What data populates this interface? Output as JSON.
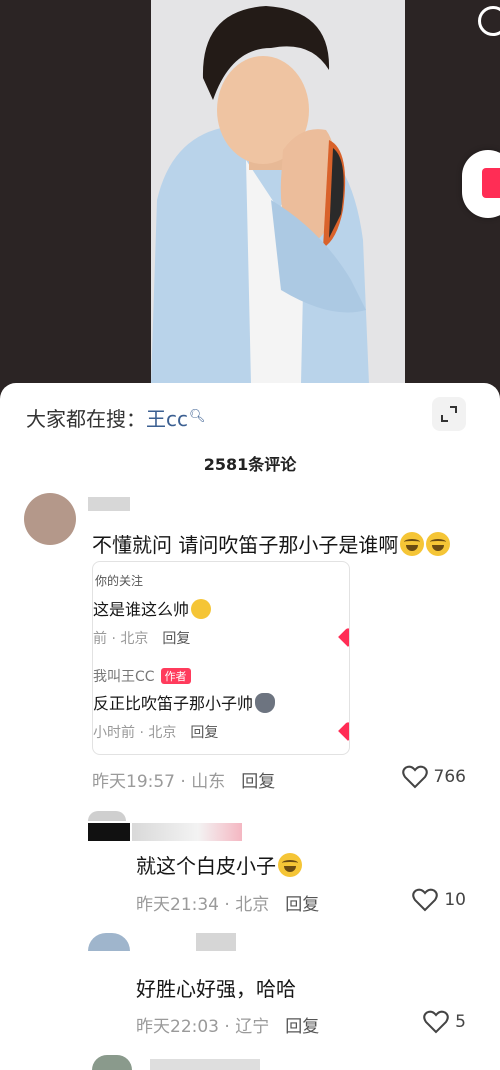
{
  "search": {
    "prefix": "大家都在搜：",
    "keyword": "王cc"
  },
  "comment_count": "2581条评论",
  "comments": [
    {
      "text": "不懂就问 请问吹笛子那小子是谁啊",
      "time": "昨天19:57",
      "location": "山东",
      "reply_label": "回复",
      "likes": "766",
      "quote": {
        "tag": "你的关注",
        "line1": "这是谁这么帅",
        "meta1_time": "前",
        "meta1_loc": "北京",
        "reply1": "回复",
        "user2": "我叫王CC",
        "author_badge": "作者",
        "line2": "反正比吹笛子那小子帅",
        "meta2_time": "小时前",
        "meta2_loc": "北京",
        "reply2": "回复"
      }
    },
    {
      "text": "就这个白皮小子",
      "time": "昨天21:34",
      "location": "北京",
      "reply_label": "回复",
      "likes": "10"
    },
    {
      "text": "好胜心好强，哈哈",
      "time": "昨天22:03",
      "location": "辽宁",
      "reply_label": "回复",
      "likes": "5"
    }
  ],
  "colors": {
    "accent_red": "#ff2d55",
    "link_blue": "#3b5f91"
  }
}
